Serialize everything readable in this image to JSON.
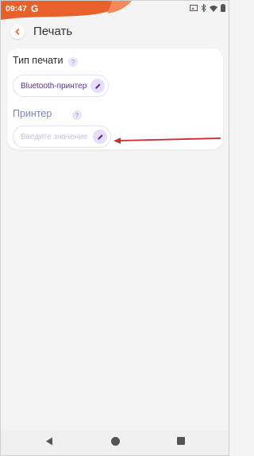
{
  "status_bar": {
    "time": "09:47",
    "app_letter": "G",
    "icons": [
      "screen-cast-icon",
      "bluetooth-icon",
      "wifi-icon",
      "battery-icon"
    ]
  },
  "header": {
    "title": "Печать",
    "back_icon": "chevron-left-icon"
  },
  "card": {
    "print_type": {
      "label": "Тип печати",
      "help": "?",
      "value": "Bluetooth-принтер",
      "edit_icon": "pencil-icon"
    },
    "printer": {
      "label": "Принтер",
      "help": "?",
      "value": "",
      "placeholder": "Введите значение",
      "edit_icon": "pencil-icon"
    }
  },
  "annotation": {
    "arrow_color": "#d62828"
  },
  "colors": {
    "accent_orange": "#e8612c",
    "accent_purple": "#5c2d91",
    "label_muted": "#7f86b3"
  },
  "nav_bar": {
    "icons": [
      "nav-back-icon",
      "nav-home-icon",
      "nav-recents-icon"
    ]
  }
}
